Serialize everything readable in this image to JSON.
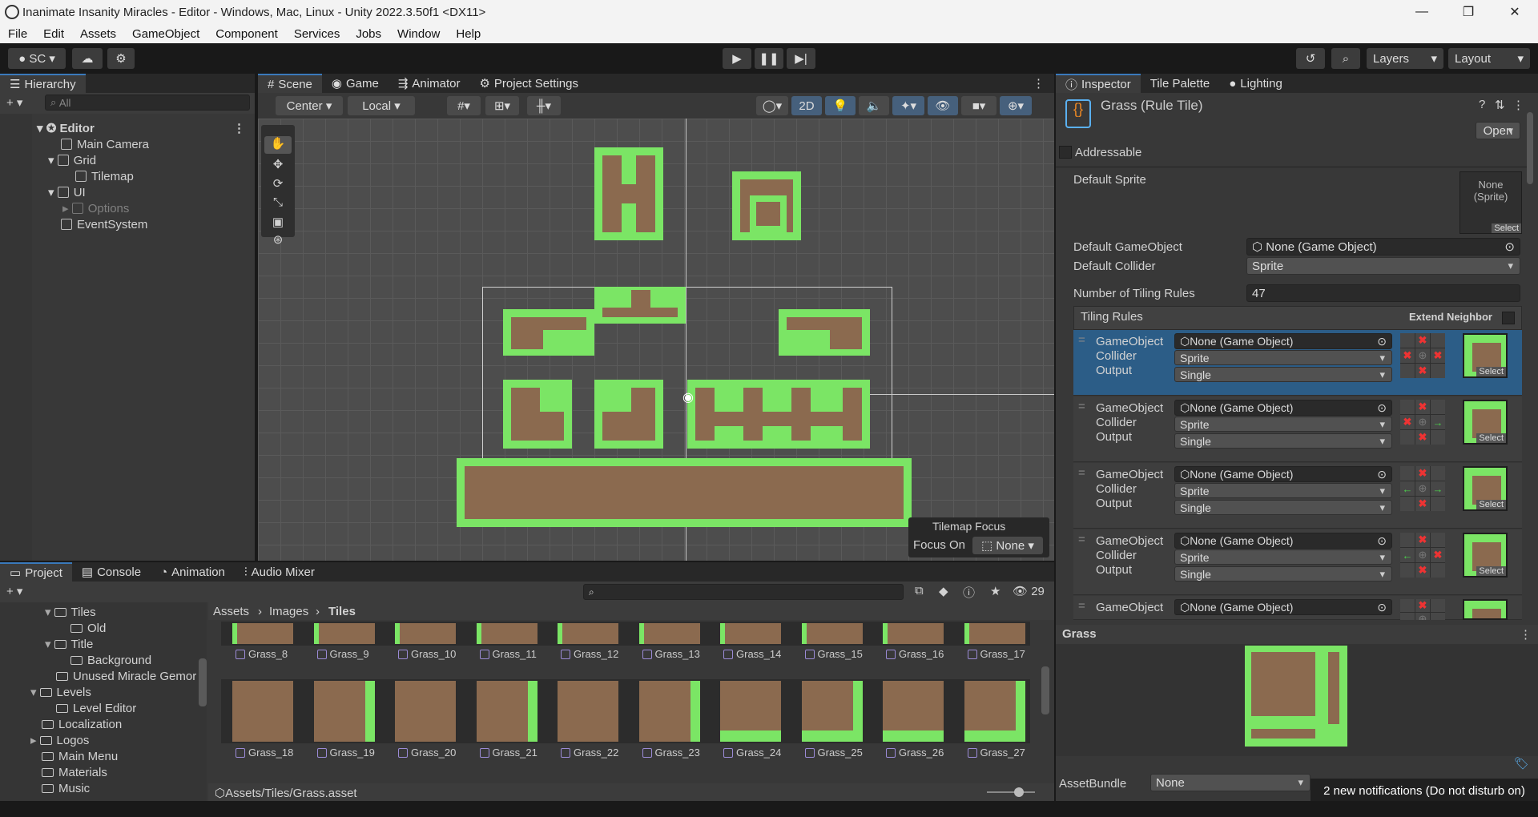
{
  "window": {
    "title": "Inanimate Insanity Miracles - Editor - Windows, Mac, Linux - Unity 2022.3.50f1 <DX11>"
  },
  "menu": [
    "File",
    "Edit",
    "Assets",
    "GameObject",
    "Component",
    "Services",
    "Jobs",
    "Window",
    "Help"
  ],
  "toolbar": {
    "account": "SC",
    "layers": "Layers",
    "layout": "Layout"
  },
  "hierarchy": {
    "tab": "Hierarchy",
    "search_placeholder": "All",
    "items": [
      {
        "label": "Editor"
      },
      {
        "label": "Main Camera"
      },
      {
        "label": "Grid"
      },
      {
        "label": "Tilemap"
      },
      {
        "label": "UI"
      },
      {
        "label": "Options"
      },
      {
        "label": "EventSystem"
      }
    ]
  },
  "scene": {
    "tabs": [
      "Scene",
      "Game",
      "Animator",
      "Project Settings"
    ],
    "pivot": "Center",
    "space": "Local",
    "mode2d": "2D",
    "tilemap_focus": {
      "title": "Tilemap Focus",
      "label": "Focus On",
      "value": "None"
    }
  },
  "inspector": {
    "tabs": [
      "Inspector",
      "Tile Palette",
      "Lighting"
    ],
    "asset_title": "Grass (Rule Tile)",
    "open_button": "Open",
    "addressable": "Addressable",
    "default_sprite": {
      "label": "Default Sprite",
      "value": "None\n(Sprite)",
      "select": "Select"
    },
    "default_gameobject": {
      "label": "Default GameObject",
      "value": "None (Game Object)"
    },
    "default_collider": {
      "label": "Default Collider",
      "value": "Sprite"
    },
    "num_rules": {
      "label": "Number of Tiling Rules",
      "value": "47"
    },
    "tiling_rules": {
      "label": "Tiling Rules",
      "extend": "Extend Neighbor"
    },
    "rules": [
      {
        "gameobject": "None (Game Object)",
        "collider": "Sprite",
        "output": "Single",
        "grid": [
          "",
          "x",
          "",
          "x",
          "",
          "x",
          "",
          "x",
          ""
        ],
        "select": "Select"
      },
      {
        "gameobject": "None (Game Object)",
        "collider": "Sprite",
        "output": "Single",
        "grid": [
          "",
          "x",
          "",
          "x",
          "",
          "→",
          "",
          "x",
          ""
        ],
        "select": "Select"
      },
      {
        "gameobject": "None (Game Object)",
        "collider": "Sprite",
        "output": "Single",
        "grid": [
          "",
          "x",
          "",
          "←",
          "",
          "→",
          "",
          "x",
          ""
        ],
        "select": "Select"
      },
      {
        "gameobject": "None (Game Object)",
        "collider": "Sprite",
        "output": "Single",
        "grid": [
          "",
          "x",
          "",
          "←",
          "",
          "x",
          "",
          "x",
          ""
        ],
        "select": "Select"
      },
      {
        "gameobject": "None (Game Object)",
        "collider": "Sprite",
        "output": "",
        "grid": [
          "",
          "x",
          "",
          "",
          "",
          "",
          "",
          "",
          ""
        ],
        "select": ""
      }
    ],
    "row_labels": {
      "gameobject": "GameObject",
      "collider": "Collider",
      "output": "Output"
    },
    "preview_title": "Grass",
    "assetbundle": {
      "label": "AssetBundle",
      "value": "None"
    }
  },
  "project": {
    "tabs": [
      "Project",
      "Console",
      "Animation",
      "Audio Mixer"
    ],
    "count": "29",
    "tree": [
      {
        "label": "Tiles",
        "indent": 2,
        "open": true
      },
      {
        "label": "Old",
        "indent": 3
      },
      {
        "label": "Title",
        "indent": 2,
        "open": true
      },
      {
        "label": "Background",
        "indent": 3
      },
      {
        "label": "Unused Miracle Gemor",
        "indent": 2
      },
      {
        "label": "Levels",
        "indent": 1,
        "open": true
      },
      {
        "label": "Level Editor",
        "indent": 2
      },
      {
        "label": "Localization",
        "indent": 1
      },
      {
        "label": "Logos",
        "indent": 1,
        "collapsed": true
      },
      {
        "label": "Main Menu",
        "indent": 1
      },
      {
        "label": "Materials",
        "indent": 1
      },
      {
        "label": "Music",
        "indent": 1
      }
    ],
    "breadcrumb": [
      "Assets",
      "Images",
      "Tiles"
    ],
    "row1": [
      "Grass_8",
      "Grass_9",
      "Grass_10",
      "Grass_11",
      "Grass_12",
      "Grass_13",
      "Grass_14",
      "Grass_15",
      "Grass_16",
      "Grass_17"
    ],
    "row2": [
      "Grass_18",
      "Grass_19",
      "Grass_20",
      "Grass_21",
      "Grass_22",
      "Grass_23",
      "Grass_24",
      "Grass_25",
      "Grass_26",
      "Grass_27"
    ],
    "path": "Assets/Tiles/Grass.asset"
  },
  "notification": "2 new notifications (Do not disturb on)"
}
